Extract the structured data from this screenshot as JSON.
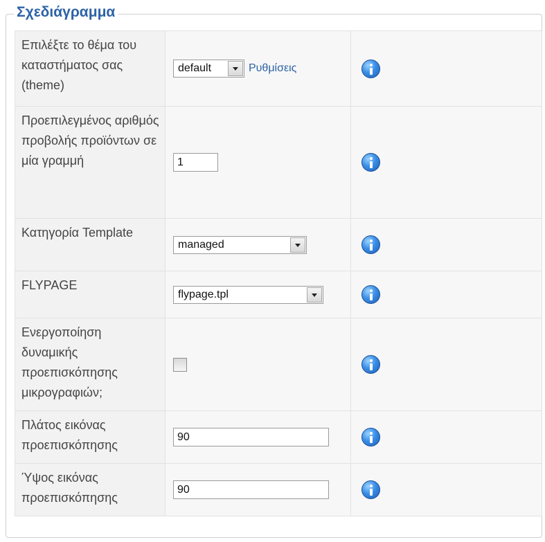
{
  "section": {
    "title": "Σχεδιάγραμμα"
  },
  "rows": [
    {
      "label": "Επιλέξτε το θέμα του καταστήματος σας (theme)",
      "select_value": "default",
      "link": "Ρυθμίσεις"
    },
    {
      "label": "Προεπιλεγμένος αριθμός προβολής προϊόντων σε μία γραμμή",
      "input_value": "1"
    },
    {
      "label": "Κατηγορία Template",
      "select_value": "managed"
    },
    {
      "label": "FLYPAGE",
      "select_value": "flypage.tpl"
    },
    {
      "label": "Ενεργοποίηση δυναμικής προεπισκόπησης μικρογραφιών;",
      "checked": false
    },
    {
      "label": "Πλάτος εικόνας προεπισκόπησης",
      "input_value": "90"
    },
    {
      "label": "Ύψος εικόνας προεπισκόπησης",
      "input_value": "90"
    }
  ],
  "icons": {
    "info": "info-icon"
  },
  "colors": {
    "accent": "#2d63a6",
    "label_bg": "#f2f2f2"
  }
}
